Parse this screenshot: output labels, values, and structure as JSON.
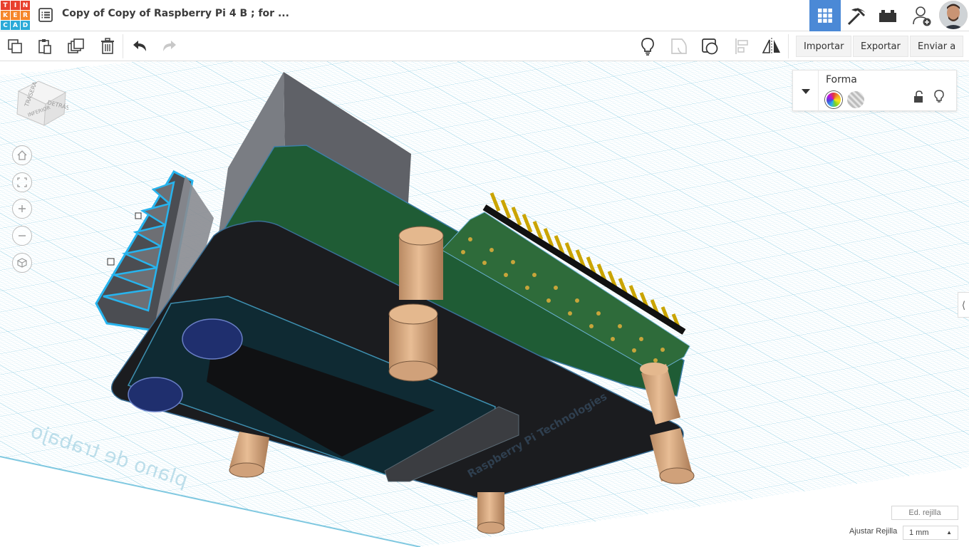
{
  "logo": {
    "letters": [
      "T",
      "I",
      "N",
      "K",
      "E",
      "R",
      "C",
      "A",
      "D"
    ],
    "colors": [
      "#e8402d",
      "#e8402d",
      "#e8402d",
      "#f5862a",
      "#f5862a",
      "#f5862a",
      "#2baad8",
      "#2baad8",
      "#2baad8"
    ]
  },
  "header": {
    "title": "Copy of Copy of Raspberry Pi 4 B ; for ...",
    "nav": [
      {
        "name": "3d-design-view-icon",
        "active": true
      },
      {
        "name": "pickaxe-icon",
        "active": false
      },
      {
        "name": "bricks-icon",
        "active": false
      },
      {
        "name": "add-user-icon",
        "active": false
      }
    ]
  },
  "toolbar": {
    "import_label": "Importar",
    "export_label": "Exportar",
    "send_label": "Enviar a"
  },
  "viewcube": {
    "top_label": "TRASERA",
    "right_label": "DETRÁS",
    "bottom_label": "INFERIOR"
  },
  "shape_panel": {
    "title": "Forma"
  },
  "pcb": {
    "brand_text": "Raspberry Pi Technologies"
  },
  "workplane": {
    "mirrored_text": "plano de trabajo"
  },
  "grid_controls": {
    "edit_grid": "Ed. rejilla",
    "snap_label": "Ajustar Rejilla",
    "snap_value": "1 mm"
  },
  "colors": {
    "accent": "#4b89d6",
    "grid": "#9fd7ea"
  }
}
